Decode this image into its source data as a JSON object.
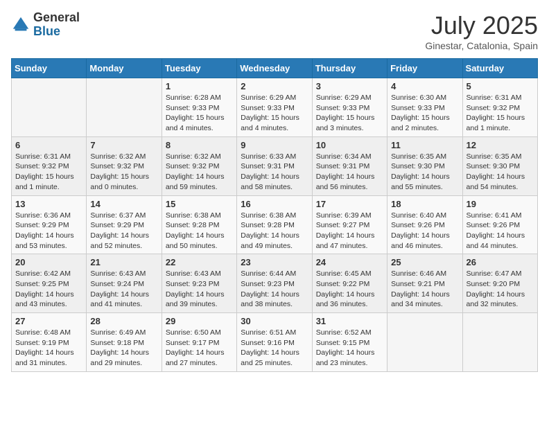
{
  "header": {
    "logo_general": "General",
    "logo_blue": "Blue",
    "month_title": "July 2025",
    "subtitle": "Ginestar, Catalonia, Spain"
  },
  "days_of_week": [
    "Sunday",
    "Monday",
    "Tuesday",
    "Wednesday",
    "Thursday",
    "Friday",
    "Saturday"
  ],
  "weeks": [
    [
      {
        "day": "",
        "info": ""
      },
      {
        "day": "",
        "info": ""
      },
      {
        "day": "1",
        "info": "Sunrise: 6:28 AM\nSunset: 9:33 PM\nDaylight: 15 hours and 4 minutes."
      },
      {
        "day": "2",
        "info": "Sunrise: 6:29 AM\nSunset: 9:33 PM\nDaylight: 15 hours and 4 minutes."
      },
      {
        "day": "3",
        "info": "Sunrise: 6:29 AM\nSunset: 9:33 PM\nDaylight: 15 hours and 3 minutes."
      },
      {
        "day": "4",
        "info": "Sunrise: 6:30 AM\nSunset: 9:33 PM\nDaylight: 15 hours and 2 minutes."
      },
      {
        "day": "5",
        "info": "Sunrise: 6:31 AM\nSunset: 9:32 PM\nDaylight: 15 hours and 1 minute."
      }
    ],
    [
      {
        "day": "6",
        "info": "Sunrise: 6:31 AM\nSunset: 9:32 PM\nDaylight: 15 hours and 1 minute."
      },
      {
        "day": "7",
        "info": "Sunrise: 6:32 AM\nSunset: 9:32 PM\nDaylight: 15 hours and 0 minutes."
      },
      {
        "day": "8",
        "info": "Sunrise: 6:32 AM\nSunset: 9:32 PM\nDaylight: 14 hours and 59 minutes."
      },
      {
        "day": "9",
        "info": "Sunrise: 6:33 AM\nSunset: 9:31 PM\nDaylight: 14 hours and 58 minutes."
      },
      {
        "day": "10",
        "info": "Sunrise: 6:34 AM\nSunset: 9:31 PM\nDaylight: 14 hours and 56 minutes."
      },
      {
        "day": "11",
        "info": "Sunrise: 6:35 AM\nSunset: 9:30 PM\nDaylight: 14 hours and 55 minutes."
      },
      {
        "day": "12",
        "info": "Sunrise: 6:35 AM\nSunset: 9:30 PM\nDaylight: 14 hours and 54 minutes."
      }
    ],
    [
      {
        "day": "13",
        "info": "Sunrise: 6:36 AM\nSunset: 9:29 PM\nDaylight: 14 hours and 53 minutes."
      },
      {
        "day": "14",
        "info": "Sunrise: 6:37 AM\nSunset: 9:29 PM\nDaylight: 14 hours and 52 minutes."
      },
      {
        "day": "15",
        "info": "Sunrise: 6:38 AM\nSunset: 9:28 PM\nDaylight: 14 hours and 50 minutes."
      },
      {
        "day": "16",
        "info": "Sunrise: 6:38 AM\nSunset: 9:28 PM\nDaylight: 14 hours and 49 minutes."
      },
      {
        "day": "17",
        "info": "Sunrise: 6:39 AM\nSunset: 9:27 PM\nDaylight: 14 hours and 47 minutes."
      },
      {
        "day": "18",
        "info": "Sunrise: 6:40 AM\nSunset: 9:26 PM\nDaylight: 14 hours and 46 minutes."
      },
      {
        "day": "19",
        "info": "Sunrise: 6:41 AM\nSunset: 9:26 PM\nDaylight: 14 hours and 44 minutes."
      }
    ],
    [
      {
        "day": "20",
        "info": "Sunrise: 6:42 AM\nSunset: 9:25 PM\nDaylight: 14 hours and 43 minutes."
      },
      {
        "day": "21",
        "info": "Sunrise: 6:43 AM\nSunset: 9:24 PM\nDaylight: 14 hours and 41 minutes."
      },
      {
        "day": "22",
        "info": "Sunrise: 6:43 AM\nSunset: 9:23 PM\nDaylight: 14 hours and 39 minutes."
      },
      {
        "day": "23",
        "info": "Sunrise: 6:44 AM\nSunset: 9:23 PM\nDaylight: 14 hours and 38 minutes."
      },
      {
        "day": "24",
        "info": "Sunrise: 6:45 AM\nSunset: 9:22 PM\nDaylight: 14 hours and 36 minutes."
      },
      {
        "day": "25",
        "info": "Sunrise: 6:46 AM\nSunset: 9:21 PM\nDaylight: 14 hours and 34 minutes."
      },
      {
        "day": "26",
        "info": "Sunrise: 6:47 AM\nSunset: 9:20 PM\nDaylight: 14 hours and 32 minutes."
      }
    ],
    [
      {
        "day": "27",
        "info": "Sunrise: 6:48 AM\nSunset: 9:19 PM\nDaylight: 14 hours and 31 minutes."
      },
      {
        "day": "28",
        "info": "Sunrise: 6:49 AM\nSunset: 9:18 PM\nDaylight: 14 hours and 29 minutes."
      },
      {
        "day": "29",
        "info": "Sunrise: 6:50 AM\nSunset: 9:17 PM\nDaylight: 14 hours and 27 minutes."
      },
      {
        "day": "30",
        "info": "Sunrise: 6:51 AM\nSunset: 9:16 PM\nDaylight: 14 hours and 25 minutes."
      },
      {
        "day": "31",
        "info": "Sunrise: 6:52 AM\nSunset: 9:15 PM\nDaylight: 14 hours and 23 minutes."
      },
      {
        "day": "",
        "info": ""
      },
      {
        "day": "",
        "info": ""
      }
    ]
  ]
}
